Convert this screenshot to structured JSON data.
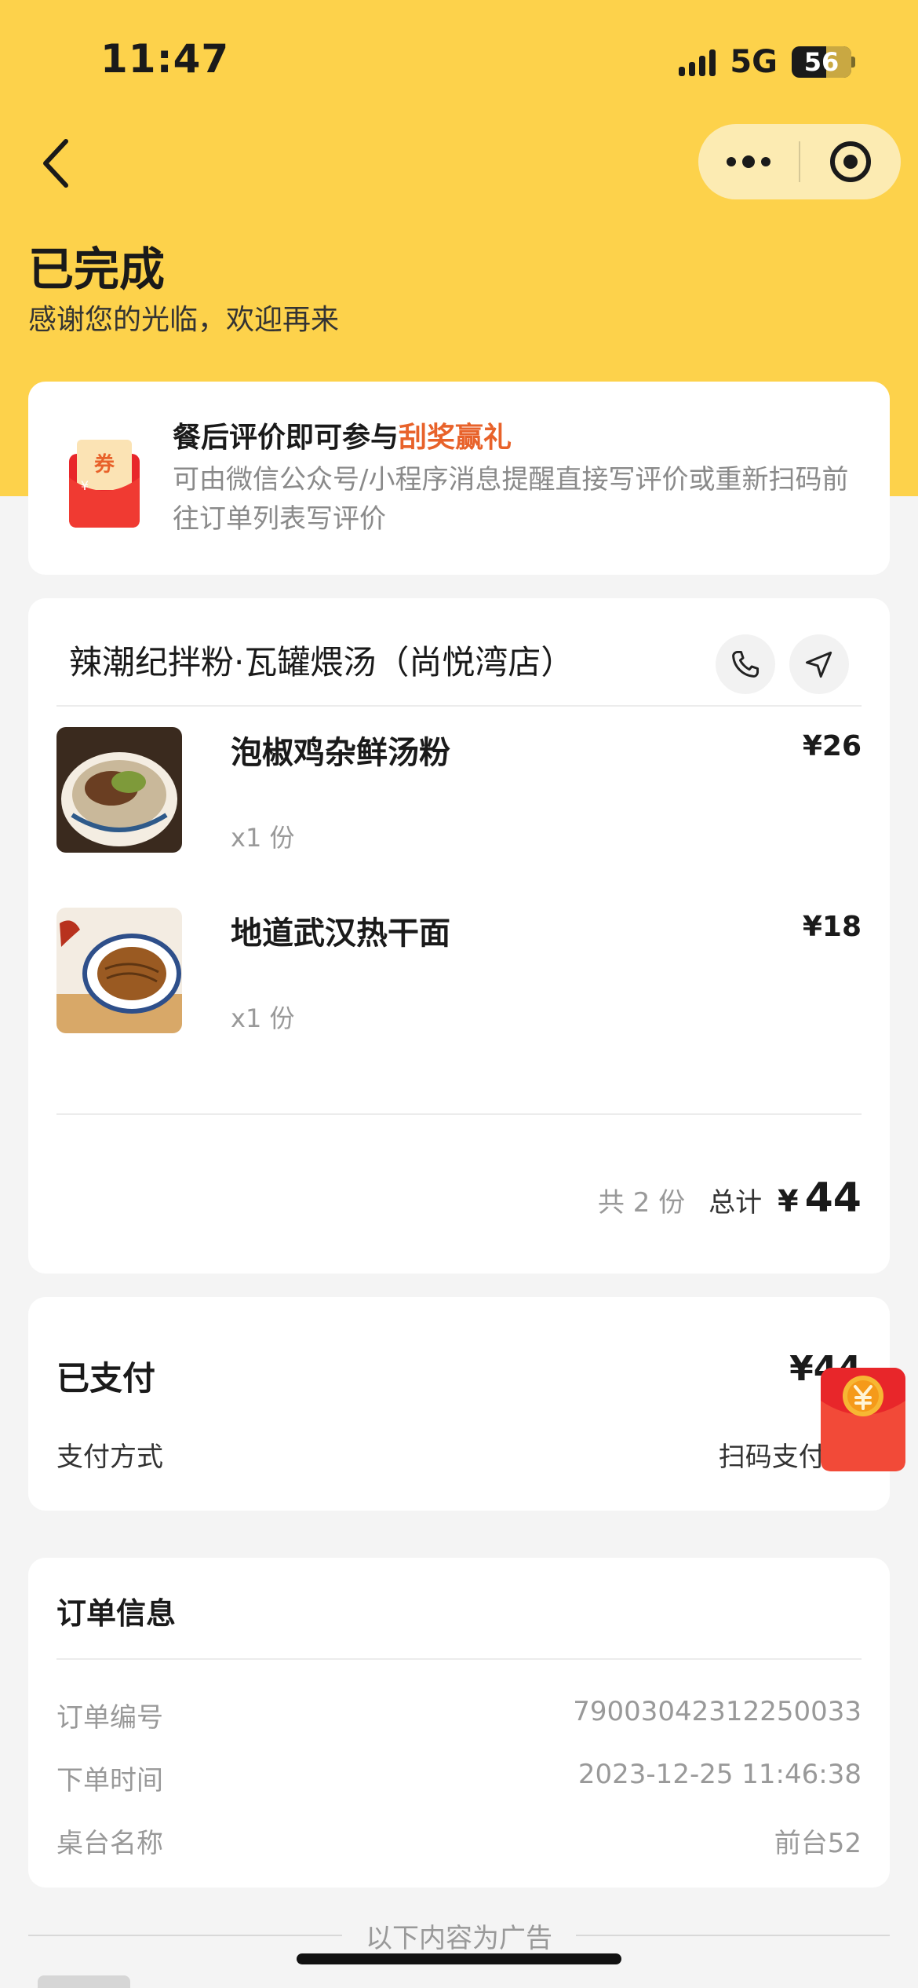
{
  "status_bar": {
    "time": "11:47",
    "network": "5G",
    "battery": "56"
  },
  "header": {
    "status": "已完成",
    "subtitle": "感谢您的光临，欢迎再来"
  },
  "promo": {
    "title_prefix": "餐后评价即可参与",
    "title_highlight": "刮奖赢礼",
    "description": "可由微信公众号/小程序消息提醒直接写评价或重新扫码前往订单列表写评价",
    "icon_text": "券",
    "icon_symbol": "¥"
  },
  "order": {
    "shop_name": "辣潮纪拌粉·瓦罐煨汤（尚悦湾店）",
    "items": [
      {
        "name": "泡椒鸡杂鲜汤粉",
        "price": "¥26",
        "qty": "x1 份"
      },
      {
        "name": "地道武汉热干面",
        "price": "¥18",
        "qty": "x1 份"
      }
    ],
    "count_label": "共 2 份",
    "total_label": "总计",
    "currency": "¥",
    "total": "44"
  },
  "payment": {
    "label": "已支付",
    "amount": "¥44",
    "method_label": "支付方式",
    "method": "扫码支付-微"
  },
  "order_info": {
    "title": "订单信息",
    "rows": [
      {
        "key": "订单编号",
        "value": "79003042312250033"
      },
      {
        "key": "下单时间",
        "value": "2023-12-25 11:46:38"
      },
      {
        "key": "桌台名称",
        "value": "前台52"
      }
    ]
  },
  "ad": {
    "divider_text": "以下内容为广告"
  },
  "colors": {
    "brand_yellow": "#fdd24b",
    "highlight_orange": "#e8622a",
    "red_packet": "#e8262a"
  }
}
